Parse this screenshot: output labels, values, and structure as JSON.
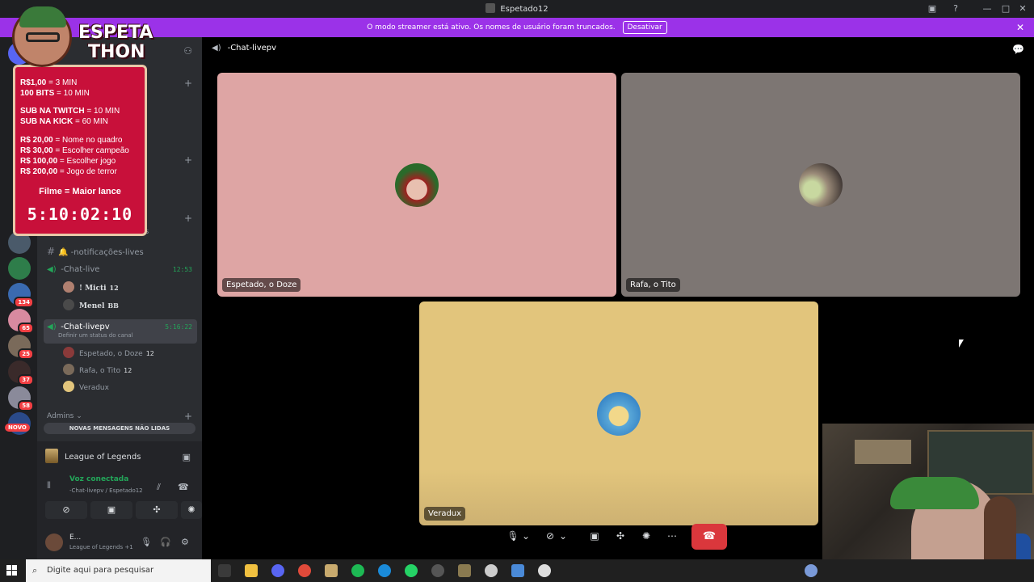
{
  "window": {
    "title": "Espetado12",
    "minimize": "—",
    "maximize": "□",
    "close": "✕"
  },
  "banner": {
    "text": "O modo streamer está ativo. Os nomes de usuário foram truncados.",
    "button": "Desativar",
    "close": "✕"
  },
  "rail": {
    "badges": [
      "134",
      "65",
      "25",
      "37",
      "58"
    ],
    "novo": "NOVO"
  },
  "overlay": {
    "title_line1": "ESPETA",
    "title_line2": "THON",
    "lines": [
      {
        "key": "R$1,00",
        "value": " = 3 MIN"
      },
      {
        "key": "100 BITS",
        "value": " = 10 MIN"
      },
      {
        "key": "SUB NA TWITCH",
        "value": " = 10 MIN"
      },
      {
        "key": "SUB NA KICK",
        "value": " = 60 MIN"
      },
      {
        "key": "R$ 20,00",
        "value": " = Nome no quadro"
      },
      {
        "key": "R$ 30,00",
        "value": " = Escolher campeão"
      },
      {
        "key": "R$ 100,00",
        "value": " = Escolher jogo"
      },
      {
        "key": "R$ 200,00",
        "value": " = Jogo de terror"
      }
    ],
    "movie": "Filme = Maior lance",
    "timer": "5:10:02:10"
  },
  "sidebar": {
    "partial_lives": "es",
    "channels": {
      "notifications": "-notificações-lives",
      "chat_live": {
        "name": "-Chat-live",
        "time": "12:53"
      },
      "chat_livepv": {
        "name": "-Chat-livepv",
        "time": "5:16:22",
        "status": "Definir um status do canal"
      }
    },
    "chat_live_members": [
      {
        "name": "! Micti",
        "tag": "12"
      },
      {
        "name": "Menel",
        "tag": "BB"
      }
    ],
    "livepv_members": [
      {
        "name": "Espetado, o Doze",
        "tag": "12"
      },
      {
        "name": "Rafa, o Tito",
        "tag": "12"
      },
      {
        "name": "Veradux",
        "tag": ""
      }
    ],
    "admins": "Admins",
    "unread": "NOVAS MENSAGENS NÃO LIDAS"
  },
  "panel": {
    "game": "League of Legends",
    "voice_status": "Voz conectada",
    "voice_channel": "-Chat-livepv / Espetado12",
    "user_name": "E...",
    "user_status": "League of Legends +1"
  },
  "main": {
    "channel": "-Chat-livepv",
    "tiles": [
      {
        "name": "Espetado, o Doze",
        "bg": "#dea5a4"
      },
      {
        "name": "Rafa, o Tito",
        "bg": "#7d7673"
      },
      {
        "name": "Veradux",
        "bg": "#e2c57c"
      }
    ]
  },
  "taskbar": {
    "search_placeholder": "Digite aqui para pesquisar"
  },
  "colors": {
    "accent": "#9b32e8",
    "online": "#23a559",
    "danger": "#da373c"
  }
}
